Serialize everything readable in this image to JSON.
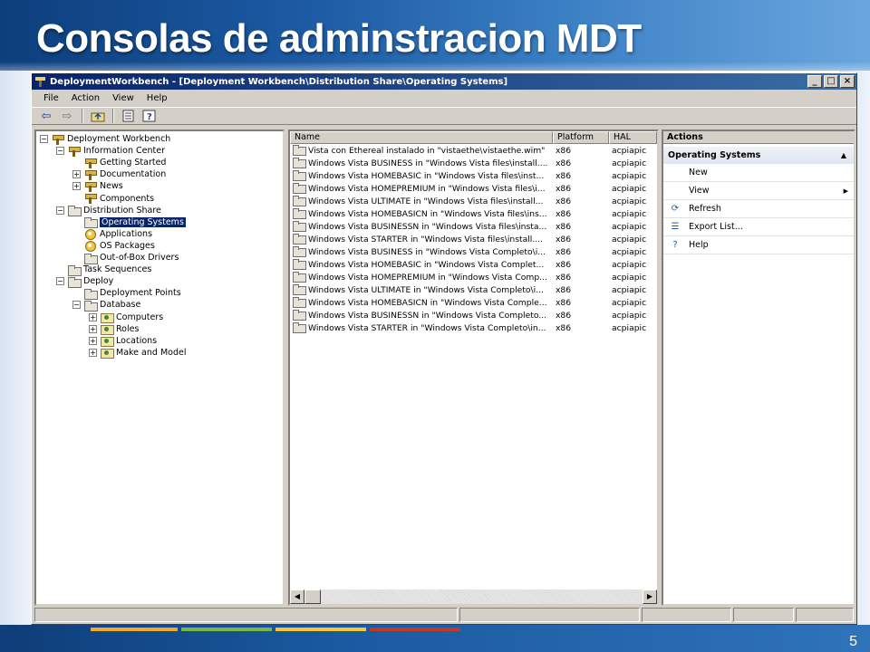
{
  "slide": {
    "title": "Consolas de adminstracion MDT",
    "page_number": "5",
    "strip_colors": [
      "#f0a830",
      "#7ab648",
      "#f6c540",
      "#c0392b",
      "#e67e22"
    ]
  },
  "window": {
    "title": "DeploymentWorkbench - [Deployment Workbench\\Distribution Share\\Operating Systems]",
    "buttons": {
      "minimize": "_",
      "maximize": "□",
      "close": "×"
    }
  },
  "menu": [
    "File",
    "Action",
    "View",
    "Help"
  ],
  "toolbar": [
    "back-icon",
    "forward-icon",
    "up-folder-icon",
    "export-list-icon",
    "help-icon"
  ],
  "tree": [
    {
      "label": "Deployment Workbench",
      "icon": "workbench",
      "expander": "−"
    },
    {
      "label": "Information Center",
      "icon": "workbench",
      "expander": "−"
    },
    {
      "label": "Getting Started",
      "icon": "workbench",
      "expander": ""
    },
    {
      "label": "Documentation",
      "icon": "workbench",
      "expander": "+"
    },
    {
      "label": "News",
      "icon": "workbench",
      "expander": "+"
    },
    {
      "label": "Components",
      "icon": "workbench",
      "expander": ""
    },
    {
      "label": "Distribution Share",
      "icon": "folder",
      "expander": "−"
    },
    {
      "label": "Operating Systems",
      "icon": "folder",
      "expander": "",
      "selected": true
    },
    {
      "label": "Applications",
      "icon": "gear",
      "expander": ""
    },
    {
      "label": "OS Packages",
      "icon": "gear",
      "expander": ""
    },
    {
      "label": "Out-of-Box Drivers",
      "icon": "folder",
      "expander": ""
    },
    {
      "label": "Task Sequences",
      "icon": "folder",
      "expander": ""
    },
    {
      "label": "Deploy",
      "icon": "folder",
      "expander": "−"
    },
    {
      "label": "Deployment Points",
      "icon": "folder",
      "expander": ""
    },
    {
      "label": "Database",
      "icon": "folder",
      "expander": "−"
    },
    {
      "label": "Computers",
      "icon": "db",
      "expander": "+"
    },
    {
      "label": "Roles",
      "icon": "db",
      "expander": "+"
    },
    {
      "label": "Locations",
      "icon": "db",
      "expander": "+"
    },
    {
      "label": "Make and Model",
      "icon": "db",
      "expander": "+"
    }
  ],
  "list": {
    "columns": [
      "Name",
      "Platform",
      "HAL"
    ],
    "rows": [
      {
        "name": "Vista con Ethereal instalado in \"vistaethe\\vistaethe.wim\"",
        "platform": "x86",
        "hal": "acpiapic"
      },
      {
        "name": "Windows Vista BUSINESS in \"Windows Vista files\\install....",
        "platform": "x86",
        "hal": "acpiapic"
      },
      {
        "name": "Windows Vista HOMEBASIC in \"Windows Vista files\\inst...",
        "platform": "x86",
        "hal": "acpiapic"
      },
      {
        "name": "Windows Vista HOMEPREMIUM in \"Windows Vista files\\i...",
        "platform": "x86",
        "hal": "acpiapic"
      },
      {
        "name": "Windows Vista ULTIMATE in \"Windows Vista files\\install...",
        "platform": "x86",
        "hal": "acpiapic"
      },
      {
        "name": "Windows Vista HOMEBASICN in \"Windows Vista files\\ins...",
        "platform": "x86",
        "hal": "acpiapic"
      },
      {
        "name": "Windows Vista BUSINESSN in \"Windows Vista files\\insta...",
        "platform": "x86",
        "hal": "acpiapic"
      },
      {
        "name": "Windows Vista STARTER in \"Windows Vista files\\install....",
        "platform": "x86",
        "hal": "acpiapic"
      },
      {
        "name": "Windows Vista BUSINESS in \"Windows Vista Completo\\i...",
        "platform": "x86",
        "hal": "acpiapic"
      },
      {
        "name": "Windows Vista HOMEBASIC in \"Windows Vista Complet...",
        "platform": "x86",
        "hal": "acpiapic"
      },
      {
        "name": "Windows Vista HOMEPREMIUM in \"Windows Vista Comp...",
        "platform": "x86",
        "hal": "acpiapic"
      },
      {
        "name": "Windows Vista ULTIMATE in \"Windows Vista Completo\\i...",
        "platform": "x86",
        "hal": "acpiapic"
      },
      {
        "name": "Windows Vista HOMEBASICN in \"Windows Vista Comple...",
        "platform": "x86",
        "hal": "acpiapic"
      },
      {
        "name": "Windows Vista BUSINESSN in \"Windows Vista Completo...",
        "platform": "x86",
        "hal": "acpiapic"
      },
      {
        "name": "Windows Vista STARTER in \"Windows Vista Completo\\in...",
        "platform": "x86",
        "hal": "acpiapic"
      }
    ]
  },
  "actions": {
    "header": "Actions",
    "section": "Operating Systems",
    "items": [
      {
        "label": "New",
        "icon": "",
        "submenu": false
      },
      {
        "label": "View",
        "icon": "",
        "submenu": true
      },
      {
        "label": "Refresh",
        "icon": "refresh-icon",
        "submenu": false
      },
      {
        "label": "Export List...",
        "icon": "export-list-icon",
        "submenu": false
      },
      {
        "label": "Help",
        "icon": "help-icon",
        "submenu": false
      }
    ]
  }
}
